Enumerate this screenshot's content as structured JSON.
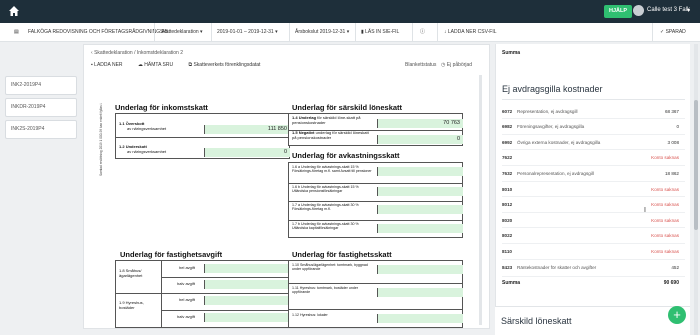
{
  "topbar": {
    "help_label": "HJÄLP",
    "user_name": "Calle test 3 Falk"
  },
  "toolbar": {
    "company": "FALKÖGA REDOVISNING OCH FÖRETAGSRÅDGIVNING AB",
    "declaration_type": "Skattedeklaration",
    "period": "2019-01-01 – 2019-12-31",
    "fiscal_year_end": "Årsbokslut 2019-12-31",
    "read_sie": "LÄS IN SIE-FIL",
    "download_csv": "LADDA NER CSV-FIL",
    "save": "SPARAD"
  },
  "left_tabs": [
    "INK2-2019P4",
    "INKDR-2019P4",
    "INK2S-2019P4"
  ],
  "doc": {
    "breadcrumb_parent": "Skattedeklaration",
    "breadcrumb_current": "Inkomstdeklaration 2",
    "download_label": "LADDA NER",
    "sru_label": "HÄMTA SRU",
    "skatteverket_label": "Skatteverkets förenklingsdatat",
    "blank_status_label": "Blankettstatus",
    "status_value": "Ej påbörjad"
  },
  "form": {
    "side_text": "Samlad ersättning 2019 1 000-99 kan enkelt fyllas i.",
    "sections": {
      "inkomstskatt": "Underlag för inkomstskatt",
      "sarskild": "Underlag för särskild löneskatt",
      "avkastning": "Underlag för avkastningsskatt",
      "fastighetsavgift": "Underlag för fastighetsavgift",
      "fastighetsskatt": "Underlag för fastighetsskatt"
    },
    "fields": {
      "f11_code": "1.1",
      "f11_bold": "Överskott",
      "f11_rest": "av näringsverksamhet",
      "f11_value": "111 850",
      "f12_code": "1.2",
      "f12_bold": "Underskott",
      "f12_rest": "av näringsverksamhet",
      "f12_value": "0",
      "f14_code": "1.4",
      "f14_bold": "Underlag",
      "f14_rest": "för särskild löne-skatt på pensionskostnader",
      "f14_value": "70 763",
      "f15_code": "1.5",
      "f15_bold": "Negativt",
      "f15_rest": "underlag för särskild löneskatt på pensionskostnader",
      "f15_value": "0",
      "f16a": "1.6 a Underlag för avkastnings-skatt 15 % Försäkrings-företag m.fl. samt Avsatt till pensioner",
      "f16b": "1.6 b Underlag för avkastnings-skatt 15 % Utländska pensionsförsäkringar",
      "f17a": "1.7 a Underlag för avkastnings-skatt 30 % Försäkrings-företag m.fl.",
      "f17b": "1.7 b Underlag för avkastnings-skatt 30 % Utländska kapitalförsäkringar",
      "f18": "1.8 Småhus/ ägarlägenhet",
      "f19": "1.9 Hyreshus, bostäder",
      "hel_avgift": "hel avgift",
      "halv_avgift": "halv avgift",
      "f110": "1.10 Småhus/ägarlägenhet: tomtmark, byggnad under uppförande",
      "f111": "1.11 Hyreshus: tomtmark, bostäder under uppförande",
      "f112": "1.12 Hyreshus: lokaler"
    }
  },
  "right": {
    "summa_top": "Summa",
    "section_title": "Ej avdragsgilla kostnader",
    "rows": [
      {
        "code": "6072",
        "desc": "Representation, ej avdragsgill",
        "value": "68 367",
        "red": false
      },
      {
        "code": "6982",
        "desc": "Föreningsavgifter, ej avdragsgilla",
        "value": "0",
        "red": false
      },
      {
        "code": "6992",
        "desc": "Övriga externa kostnader, ej avdragsgilla",
        "value": "3 008",
        "red": false
      },
      {
        "code": "7622",
        "desc": "",
        "value": "Konto saknas",
        "red": true
      },
      {
        "code": "7632",
        "desc": "Personalrepresentation, ej avdragsgill",
        "value": "18 862",
        "red": false
      },
      {
        "code": "8010",
        "desc": "",
        "value": "Konto saknas",
        "red": true
      },
      {
        "code": "8012",
        "desc": "",
        "value": "Konto saknas",
        "red": true
      },
      {
        "code": "8020",
        "desc": "",
        "value": "Konto saknas",
        "red": true
      },
      {
        "code": "8022",
        "desc": "",
        "value": "Konto saknas",
        "red": true
      },
      {
        "code": "8110",
        "desc": "",
        "value": "Konto saknas",
        "red": true
      },
      {
        "code": "8423",
        "desc": "Räntekostnader för skatter och avgifter",
        "value": "452",
        "red": false
      }
    ],
    "summa_label": "Summa",
    "summa_value": "90 690",
    "bottom_title": "Särskild löneskatt",
    "fab_label": "+"
  }
}
